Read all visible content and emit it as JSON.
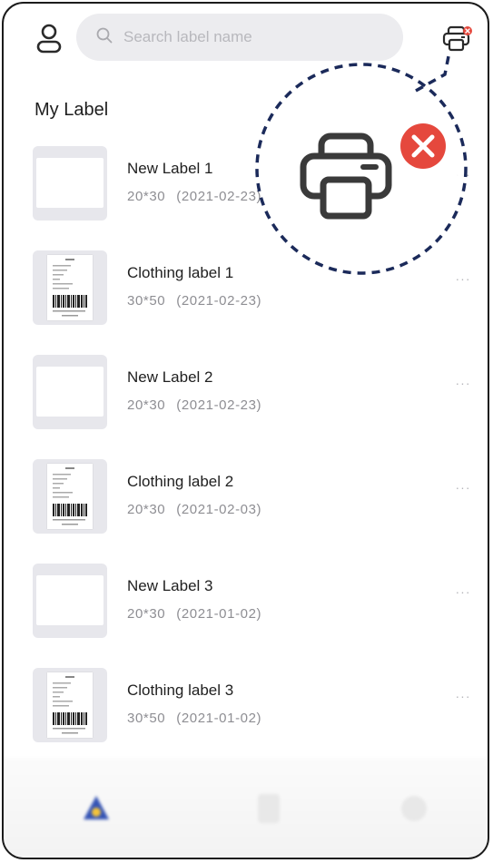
{
  "search": {
    "placeholder": "Search label name"
  },
  "section": {
    "title": "My Label"
  },
  "labels": [
    {
      "name": "New Label 1",
      "size": "20*30",
      "date": "(2021-02-23)",
      "type": "blank"
    },
    {
      "name": "Clothing label 1",
      "size": "30*50",
      "date": "(2021-02-23)",
      "type": "tag"
    },
    {
      "name": "New Label 2",
      "size": "20*30",
      "date": "(2021-02-23)",
      "type": "blank"
    },
    {
      "name": "Clothing label 2",
      "size": "20*30",
      "date": "(2021-02-03)",
      "type": "tag"
    },
    {
      "name": "New Label 3",
      "size": "20*30",
      "date": "(2021-01-02)",
      "type": "blank"
    },
    {
      "name": "Clothing label 3",
      "size": "30*50",
      "date": "(2021-01-02)",
      "type": "tag"
    }
  ],
  "more_glyph": "···",
  "printer_status": "disconnected",
  "colors": {
    "error_red": "#e5483d",
    "callout_navy": "#1b2a5a",
    "search_bg": "#ececef"
  },
  "icons": [
    "user-icon",
    "search-icon",
    "printer-icon",
    "error-badge-icon",
    "more-icon",
    "tab-icon"
  ]
}
